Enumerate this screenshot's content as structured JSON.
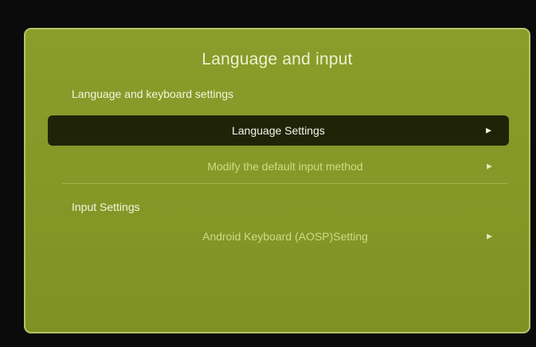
{
  "dialog": {
    "title": "Language and input",
    "sections": [
      {
        "label": "Language and keyboard settings",
        "items": [
          {
            "label": "Language Settings",
            "selected": true,
            "arrow": "▶"
          },
          {
            "label": "Modify the default input method",
            "selected": false,
            "arrow": "▶"
          }
        ]
      },
      {
        "label": "Input Settings",
        "items": [
          {
            "label": "Android Keyboard (AOSP)Setting",
            "selected": false,
            "arrow": "▶"
          }
        ]
      }
    ]
  },
  "colors": {
    "screen_bg": "#0b0b0b",
    "panel_bg": "#869826",
    "panel_border": "#b3c466",
    "selected_bg": "#1f2409",
    "selected_text": "#f4f6e6",
    "item_text": "#cfdb87"
  },
  "icons": {
    "submenu_arrow": "chevron-right-icon"
  }
}
